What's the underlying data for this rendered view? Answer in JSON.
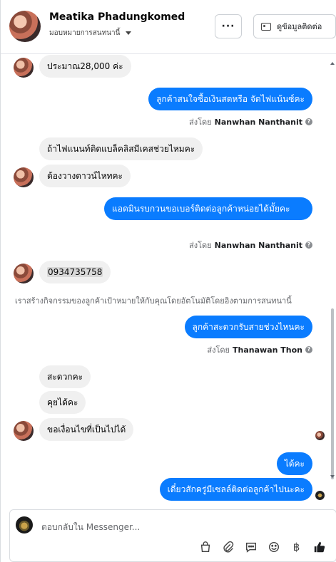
{
  "header": {
    "name": "Meatika Phadungkomed",
    "assign_label": "มอบหมายการสนทนานี้",
    "more_label": "···",
    "contact_label": "ดูข้อมูลติดต่อ"
  },
  "messages": [
    {
      "side": "in",
      "text": "ประมาณ28,000 ค่ะ"
    },
    {
      "side": "out",
      "text": "ลูกค้าสนใจซื้อเงินสดหรือ จัดไฟแน้นซ์คะ",
      "sent_prefix": "ส่งโดย",
      "sent_by": "Nanwhan Nanthanit"
    },
    {
      "side": "in",
      "text": "ถ้าไฟแนนท์ติดแบล็คลิสมีเคสช่วยไหมคะ"
    },
    {
      "side": "in",
      "text": "ต้องวางดาวน์ไหทคะ"
    },
    {
      "side": "out",
      "text": "แอดมินรบกวนขอเบอร์ติดต่อลูกค้าหน่อยได้มั้ยคะ",
      "sent_prefix": "ส่งโดย",
      "sent_by": "Nanwhan Nanthanit"
    },
    {
      "side": "in",
      "text": "0934735758"
    },
    {
      "side": "out",
      "text": "ลูกค้าสะดวกรับสายช่วงไหนคะ",
      "sent_prefix": "ส่งโดย",
      "sent_by": "Thanawan Thon"
    },
    {
      "side": "in",
      "text": "สะดวกคะ"
    },
    {
      "side": "in",
      "text": "คุยได้คะ"
    },
    {
      "side": "in",
      "text": "ขอเงื่อนไขที่เป็นไปได้"
    },
    {
      "side": "out",
      "text": "ได้คะ"
    },
    {
      "side": "out",
      "text": "เดี๋ยวสักครู่มีเซลล์ติดต่อลูกค้าไปนะคะ"
    }
  ],
  "system_note": "เราสร้างกิจกรรมของลูกค้าเป้าหมายให้กับคุณโดยอัตโนมัติโดยอิงตามการสนทนานี้",
  "composer": {
    "placeholder": "ตอบกลับใน Messenger..."
  },
  "icons": {
    "bag": "shopping-bag-icon",
    "attach": "paperclip-icon",
    "saved_reply": "chat-bubble-icon",
    "emoji": "smiley-icon",
    "payment": "baht-icon",
    "like": "thumbs-up-icon"
  },
  "colors": {
    "outgoing_bubble": "#0a7cff",
    "incoming_bubble": "#f0f0f0"
  }
}
